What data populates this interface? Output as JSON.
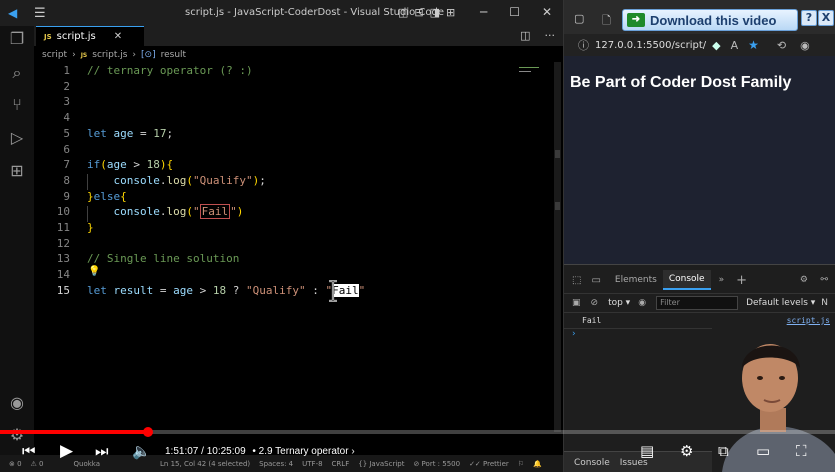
{
  "vscode": {
    "window_title": "script.js - JavaScript-CoderDost - Visual Studio Code",
    "tab": {
      "badge": "JS",
      "name": "script.js"
    },
    "breadcrumb": [
      "script",
      "script.js",
      "result"
    ],
    "code": [
      {
        "n": "1",
        "tokens": [
          {
            "t": "cm",
            "v": "// ternary operator (? :)"
          }
        ]
      },
      {
        "n": "2",
        "tokens": []
      },
      {
        "n": "3",
        "tokens": []
      },
      {
        "n": "4",
        "tokens": []
      },
      {
        "n": "5",
        "tokens": [
          {
            "t": "kw",
            "v": "let "
          },
          {
            "t": "id",
            "v": "age"
          },
          {
            "t": "op",
            "v": " = "
          },
          {
            "t": "num",
            "v": "17"
          },
          {
            "t": "op",
            "v": ";"
          }
        ]
      },
      {
        "n": "6",
        "tokens": []
      },
      {
        "n": "7",
        "tokens": [
          {
            "t": "kw",
            "v": "if"
          },
          {
            "t": "br",
            "v": "("
          },
          {
            "t": "id",
            "v": "age"
          },
          {
            "t": "op",
            "v": " > "
          },
          {
            "t": "num",
            "v": "18"
          },
          {
            "t": "br",
            "v": "){"
          }
        ]
      },
      {
        "n": "8",
        "tokens": [
          {
            "t": "op",
            "v": "    "
          },
          {
            "t": "id",
            "v": "console"
          },
          {
            "t": "op",
            "v": "."
          },
          {
            "t": "fn",
            "v": "log"
          },
          {
            "t": "br",
            "v": "("
          },
          {
            "t": "str",
            "v": "\"Qualify\""
          },
          {
            "t": "br",
            "v": ")"
          },
          {
            "t": "op",
            "v": ";"
          }
        ]
      },
      {
        "n": "9",
        "tokens": [
          {
            "t": "br",
            "v": "}"
          },
          {
            "t": "kw",
            "v": "else"
          },
          {
            "t": "br",
            "v": "{"
          }
        ]
      },
      {
        "n": "10",
        "tokens": [
          {
            "t": "op",
            "v": "    "
          },
          {
            "t": "id",
            "v": "console"
          },
          {
            "t": "op",
            "v": "."
          },
          {
            "t": "fn",
            "v": "log"
          },
          {
            "t": "br",
            "v": "("
          },
          {
            "t": "str",
            "v": "\""
          },
          {
            "t": "str-box",
            "v": "Fail"
          },
          {
            "t": "str",
            "v": "\""
          },
          {
            "t": "br",
            "v": ")"
          }
        ]
      },
      {
        "n": "11",
        "tokens": [
          {
            "t": "br",
            "v": "}"
          }
        ]
      },
      {
        "n": "12",
        "tokens": []
      },
      {
        "n": "13",
        "tokens": [
          {
            "t": "cm",
            "v": "// Single line solution"
          }
        ]
      },
      {
        "n": "14",
        "tokens": []
      },
      {
        "n": "15",
        "tokens": [
          {
            "t": "kw",
            "v": "let "
          },
          {
            "t": "id",
            "v": "result"
          },
          {
            "t": "op",
            "v": " = "
          },
          {
            "t": "id",
            "v": "age"
          },
          {
            "t": "op",
            "v": " > "
          },
          {
            "t": "num",
            "v": "18"
          },
          {
            "t": "op",
            "v": " ? "
          },
          {
            "t": "str",
            "v": "\"Qualify\""
          },
          {
            "t": "op",
            "v": " : "
          },
          {
            "t": "str",
            "v": "\""
          },
          {
            "t": "str-sel",
            "v": "Fail"
          },
          {
            "t": "str",
            "v": "\""
          }
        ]
      }
    ],
    "active_line": "15",
    "statusbar": {
      "errors": "⊗ 0",
      "warnings": "⚠ 0",
      "quokka": "Quokka",
      "position": "Ln 15, Col 42 (4 selected)",
      "spaces": "Spaces: 4",
      "encoding": "UTF-8",
      "eol": "CRLF",
      "language": "{} JavaScript",
      "port": "⊘ Port : 5500",
      "prettier": "✓✓ Prettier"
    }
  },
  "browser": {
    "download_button": "Download this video",
    "download_help": "?",
    "download_close": "X",
    "url": "127.0.0.1:5500/script/",
    "page_heading": "Be Part of Coder Dost Family",
    "devtools": {
      "tabs": [
        "Elements",
        "Console"
      ],
      "active_tab": "Console",
      "context": "top ▾",
      "filter_placeholder": "Filter",
      "levels": "Default levels ▾",
      "extra": "N",
      "output": {
        "message": "Fail",
        "source": "script.js"
      },
      "prompt": "›",
      "drawer_tabs": [
        "Console",
        "Issues"
      ]
    }
  },
  "video": {
    "time": "1:51:07 / 10:25:09",
    "chapter": "• 2.9 Ternary operator  ›",
    "progress": 0.1775
  }
}
